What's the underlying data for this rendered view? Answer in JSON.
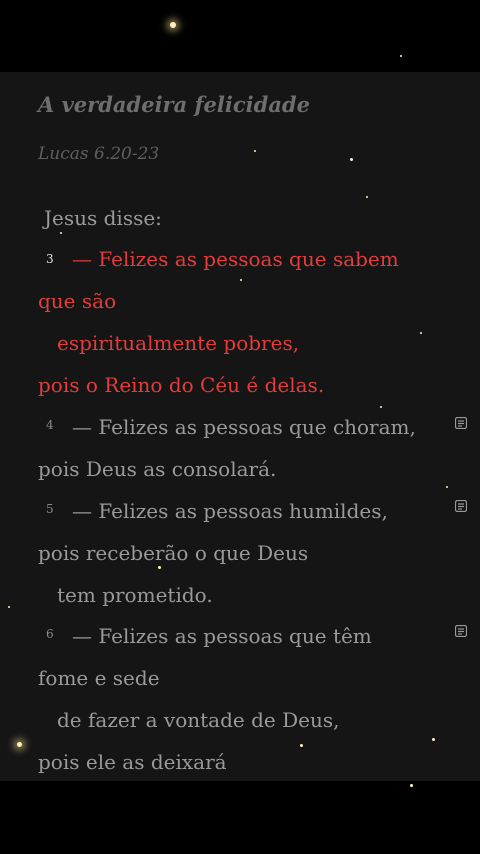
{
  "passage": {
    "title": "A verdadeira felicidade",
    "reference": "Lucas 6.20-23",
    "intro": "Jesus disse:",
    "verses": [
      {
        "number": "3",
        "lines": [
          "— Felizes as pessoas que sabem",
          "que são",
          "espiritualmente pobres,",
          "pois o Reino do Céu é delas."
        ],
        "highlighted": true,
        "has_note": false
      },
      {
        "number": "4",
        "lines": [
          "— Felizes as pessoas que choram,",
          "pois Deus as consolará."
        ],
        "highlighted": false,
        "has_note": true
      },
      {
        "number": "5",
        "lines": [
          "— Felizes as pessoas humildes,",
          "pois receberão o que Deus",
          "tem prometido."
        ],
        "highlighted": false,
        "has_note": true
      },
      {
        "number": "6",
        "lines": [
          "— Felizes as pessoas que têm",
          "fome e sede",
          "de fazer a vontade de Deus,",
          "pois ele as deixará"
        ],
        "highlighted": false,
        "has_note": true
      }
    ]
  },
  "icons": {
    "note": "note-icon"
  },
  "colors": {
    "highlight": "#e43c3c",
    "text": "#9a9a9a",
    "background": "#151515"
  }
}
